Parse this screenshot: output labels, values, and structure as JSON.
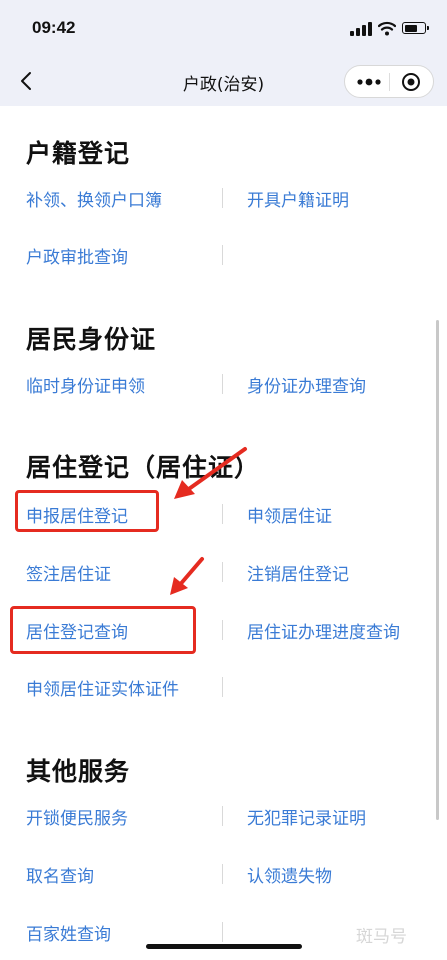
{
  "status": {
    "time": "09:42"
  },
  "nav": {
    "title": "户政(治安)"
  },
  "sections": {
    "s1": {
      "title": "户籍登记",
      "items": [
        "补领、换领户口簿",
        "开具户籍证明",
        "户政审批查询"
      ]
    },
    "s2": {
      "title": "居民身份证",
      "items": [
        "临时身份证申领",
        "身份证办理查询"
      ]
    },
    "s3": {
      "title": "居住登记（居住证）",
      "items": [
        "申报居住登记",
        "申领居住证",
        "签注居住证",
        "注销居住登记",
        "居住登记查询",
        "居住证办理进度查询",
        "申领居住证实体证件"
      ]
    },
    "s4": {
      "title": "其他服务",
      "items": [
        "开锁便民服务",
        "无犯罪记录证明",
        "取名查询",
        "认领遗失物",
        "百家姓查询"
      ]
    }
  },
  "watermark": "斑马号",
  "colors": {
    "link": "#3a7bd5",
    "highlight": "#e52b20",
    "header_bg": "#eef0f8"
  },
  "icons": [
    "back-arrow-icon",
    "more-dots-icon",
    "close-target-icon",
    "signal-icon",
    "wifi-icon",
    "battery-icon",
    "annotation-arrow-icon"
  ]
}
